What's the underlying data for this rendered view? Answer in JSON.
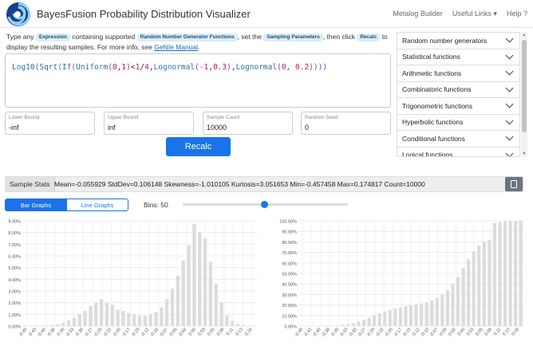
{
  "header": {
    "title": "BayesFusion Probability Distribution Visualizer",
    "nav": [
      "Metalog Builder",
      "Useful Links",
      "Help"
    ],
    "useful_links_caret": "▾",
    "help_icon": "?"
  },
  "instructions": {
    "p1": "Type any",
    "chip_expression": "Expression",
    "p2": "containing supported",
    "chip_rng": "Random Number Generator Functions",
    "p3": ", set the",
    "chip_sampling": "Sampling Parameters",
    "p4": ", then click",
    "chip_recalc": "Recalc",
    "p5": "to display the resulting samples. For more info, see",
    "manual_link": "GeNIe Manual",
    "p6": "."
  },
  "expression": "Log10(Sqrt(If(Uniform(0,1)<1/4,Lognormal(-1,0.3),Lognormal(0, 0.2))))",
  "params": {
    "lower": {
      "label": "Lower Bound",
      "value": "-inf"
    },
    "upper": {
      "label": "Upper Bound",
      "value": "inf"
    },
    "count": {
      "label": "Sample Count",
      "value": "10000"
    },
    "seed": {
      "label": "Random Seed",
      "value": "0"
    }
  },
  "recalc_label": "Recalc",
  "function_categories": [
    "Random number generators",
    "Statistical functions",
    "Arithmetic functions",
    "Combinatoric functions",
    "Trigonometric functions",
    "Hyperbolic functions",
    "Conditional functions",
    "Logical functions"
  ],
  "stats": {
    "label": "Sample Stats",
    "text": "Mean=-0.055929 StdDev=0.106148 Skewness=-1.010105 Kurtosis=3.051653 Min=-0.457458 Max=0.174817 Count=10000"
  },
  "tabs": {
    "bar": "Bar Graphs",
    "line": "Line Graphs"
  },
  "bins": {
    "label": "Bins:",
    "value": 50,
    "min": 1,
    "max": 100
  },
  "colors": {
    "accent": "#1a73e8",
    "bar": "#dcdcdc"
  },
  "chart_data": [
    {
      "type": "bar",
      "ylim": [
        0,
        9
      ],
      "yticks": [
        "0.00%",
        "1.00%",
        "2.00%",
        "3.00%",
        "4.00%",
        "5.00%",
        "6.00%",
        "7.00%",
        "8.00%",
        "9.00%"
      ],
      "categories": [
        "-0.45",
        "-0.43",
        "-0.42",
        "-0.40",
        "-0.38",
        "-0.37",
        "-0.35",
        "-0.33",
        "-0.32",
        "-0.30",
        "-0.28",
        "-0.27",
        "-0.25",
        "-0.23",
        "-0.22",
        "-0.20",
        "-0.18",
        "-0.17",
        "-0.15",
        "-0.13",
        "-0.12",
        "-0.10",
        "-0.08",
        "-0.07",
        "-0.05",
        "-0.03",
        "-0.02",
        "0.00",
        "0.02",
        "0.03",
        "0.05",
        "0.07",
        "0.08",
        "0.10",
        "0.12",
        "0.13",
        "0.15",
        "0.16"
      ],
      "xticks_shown": [
        "-0.45",
        "-0.43",
        "-0.40",
        "-0.38",
        "-0.35",
        "-0.33",
        "-0.30",
        "-0.27",
        "-0.25",
        "-0.22",
        "-0.20",
        "-0.17",
        "-0.15",
        "-0.12",
        "-0.10",
        "-0.07",
        "-0.05",
        "-0.02",
        "0.00",
        "0.03",
        "0.05",
        "0.08",
        "0.11",
        "0.13",
        "0.16"
      ],
      "values": [
        0.01,
        0.01,
        0.02,
        0.03,
        0.05,
        0.1,
        0.15,
        0.3,
        0.5,
        0.7,
        1.0,
        1.3,
        1.7,
        2.0,
        2.3,
        2.0,
        1.8,
        1.4,
        1.3,
        1.1,
        1.0,
        0.9,
        0.9,
        1.0,
        1.2,
        1.6,
        2.3,
        3.2,
        4.3,
        5.6,
        6.9,
        8.7,
        8.0,
        7.5,
        5.5,
        3.6,
        2.0,
        0.9,
        0.45,
        0.2,
        0.1,
        0.05,
        0.02
      ],
      "values_note": ""
    },
    {
      "type": "bar",
      "ylim": [
        0,
        100
      ],
      "yticks": [
        "0.00%",
        "10.00%",
        "20.00%",
        "30.00%",
        "40.00%",
        "50.00%",
        "60.00%",
        "70.00%",
        "80.00%",
        "90.00%",
        "100.00%"
      ],
      "xticks_shown": [
        "-0.45",
        "-0.43",
        "-0.40",
        "-0.38",
        "-0.35",
        "-0.33",
        "-0.30",
        "-0.27",
        "-0.25",
        "-0.22",
        "-0.20",
        "-0.17",
        "-0.15",
        "-0.12",
        "-0.10",
        "-0.07",
        "-0.05",
        "-0.02",
        "0.00",
        "0.03",
        "0.05",
        "0.08",
        "0.11",
        "0.13",
        "0.16"
      ],
      "values": [
        0.01,
        0.02,
        0.04,
        0.07,
        0.12,
        0.22,
        0.37,
        0.67,
        1.2,
        1.9,
        2.9,
        4.2,
        5.9,
        7.9,
        10.2,
        12.2,
        14.0,
        15.4,
        16.7,
        17.8,
        18.8,
        19.7,
        20.6,
        21.6,
        22.8,
        24.4,
        26.7,
        29.9,
        34.2,
        39.8,
        46.7,
        55.4,
        63.4,
        70.9,
        76.4,
        80.0,
        82.0,
        98.0,
        99.0,
        99.6,
        99.9,
        100.0,
        100.0
      ]
    }
  ]
}
